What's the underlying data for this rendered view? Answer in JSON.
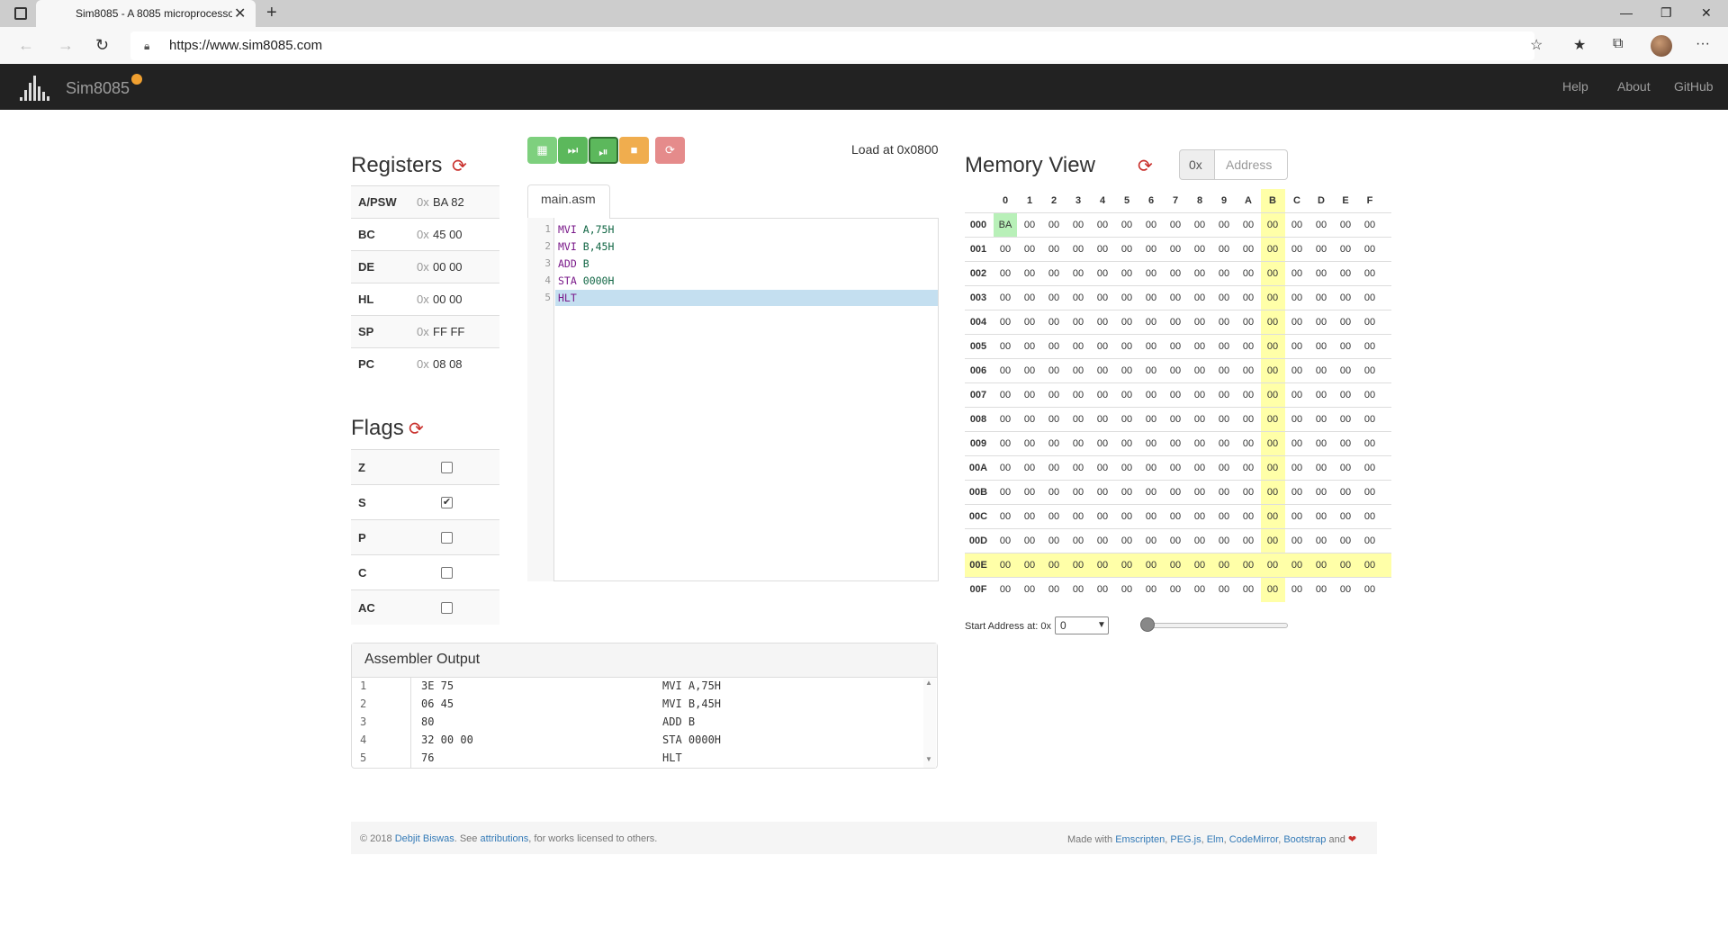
{
  "browser": {
    "tab_title": "Sim8085 - A 8085 microprocesso",
    "url": "https://www.sim8085.com",
    "tab_close": "✕",
    "new_tab": "+"
  },
  "navbar": {
    "brand": "Sim8085",
    "links": [
      "Help",
      "About",
      "GitHub"
    ]
  },
  "registers": {
    "title": "Registers",
    "prefix": "0x",
    "rows": [
      {
        "name": "A/PSW",
        "value": "BA 82"
      },
      {
        "name": "BC",
        "value": "45 00"
      },
      {
        "name": "DE",
        "value": "00 00"
      },
      {
        "name": "HL",
        "value": "00 00"
      },
      {
        "name": "SP",
        "value": "FF FF"
      },
      {
        "name": "PC",
        "value": "08 08"
      }
    ]
  },
  "flags": {
    "title": "Flags",
    "rows": [
      {
        "name": "Z",
        "checked": false
      },
      {
        "name": "S",
        "checked": true
      },
      {
        "name": "P",
        "checked": false
      },
      {
        "name": "C",
        "checked": false
      },
      {
        "name": "AC",
        "checked": false
      }
    ]
  },
  "toolbar": {
    "load_at": "Load at 0x0800",
    "colors": {
      "green": "#5cb85c",
      "green_light": "#7ed07e",
      "orange": "#f0ad4e",
      "red": "#e58b8b"
    }
  },
  "editor": {
    "tab": "main.asm",
    "lines": [
      {
        "n": "1",
        "op": "MVI",
        "arg": "A,75H"
      },
      {
        "n": "2",
        "op": "MVI",
        "arg": "B,45H"
      },
      {
        "n": "3",
        "op": "ADD",
        "arg": "B"
      },
      {
        "n": "4",
        "op": "STA",
        "arg": "0000H"
      },
      {
        "n": "5",
        "op": "HLT",
        "arg": ""
      }
    ]
  },
  "assembler": {
    "title": "Assembler Output",
    "rows": [
      {
        "n": "1",
        "hex": "3E 75",
        "src": "MVI A,75H"
      },
      {
        "n": "2",
        "hex": "06 45",
        "src": "MVI B,45H"
      },
      {
        "n": "3",
        "hex": "80",
        "src": "ADD B"
      },
      {
        "n": "4",
        "hex": "32 00 00",
        "src": "STA 0000H"
      },
      {
        "n": "5",
        "hex": "76",
        "src": "HLT"
      }
    ]
  },
  "memory": {
    "title": "Memory View",
    "addr_prefix": "0x",
    "addr_placeholder": "Address",
    "columns": [
      "0",
      "1",
      "2",
      "3",
      "4",
      "5",
      "6",
      "7",
      "8",
      "9",
      "A",
      "B",
      "C",
      "D",
      "E",
      "F"
    ],
    "rows": [
      "000",
      "001",
      "002",
      "003",
      "004",
      "005",
      "006",
      "007",
      "008",
      "009",
      "00A",
      "00B",
      "00C",
      "00D",
      "00E",
      "00F"
    ],
    "default_value": "00",
    "cells": {
      "000-0": "BA"
    },
    "highlight_column": "B",
    "highlight_row": "00E",
    "highlight_color": "#ffffa8",
    "changed_color": "#b8f0b8",
    "start_label": "Start Address at: 0x",
    "start_value": "0",
    "slider_level": 0
  },
  "footer": {
    "copyright": "© 2018",
    "author": "Debjit Biswas",
    "see": ". See",
    "attributions": "attributions",
    "rest": ", for works licensed to others.",
    "made_with": "Made with",
    "libs": [
      "Emscripten",
      "PEG.js",
      "Elm",
      "CodeMirror",
      "Bootstrap"
    ],
    "and": "and"
  }
}
